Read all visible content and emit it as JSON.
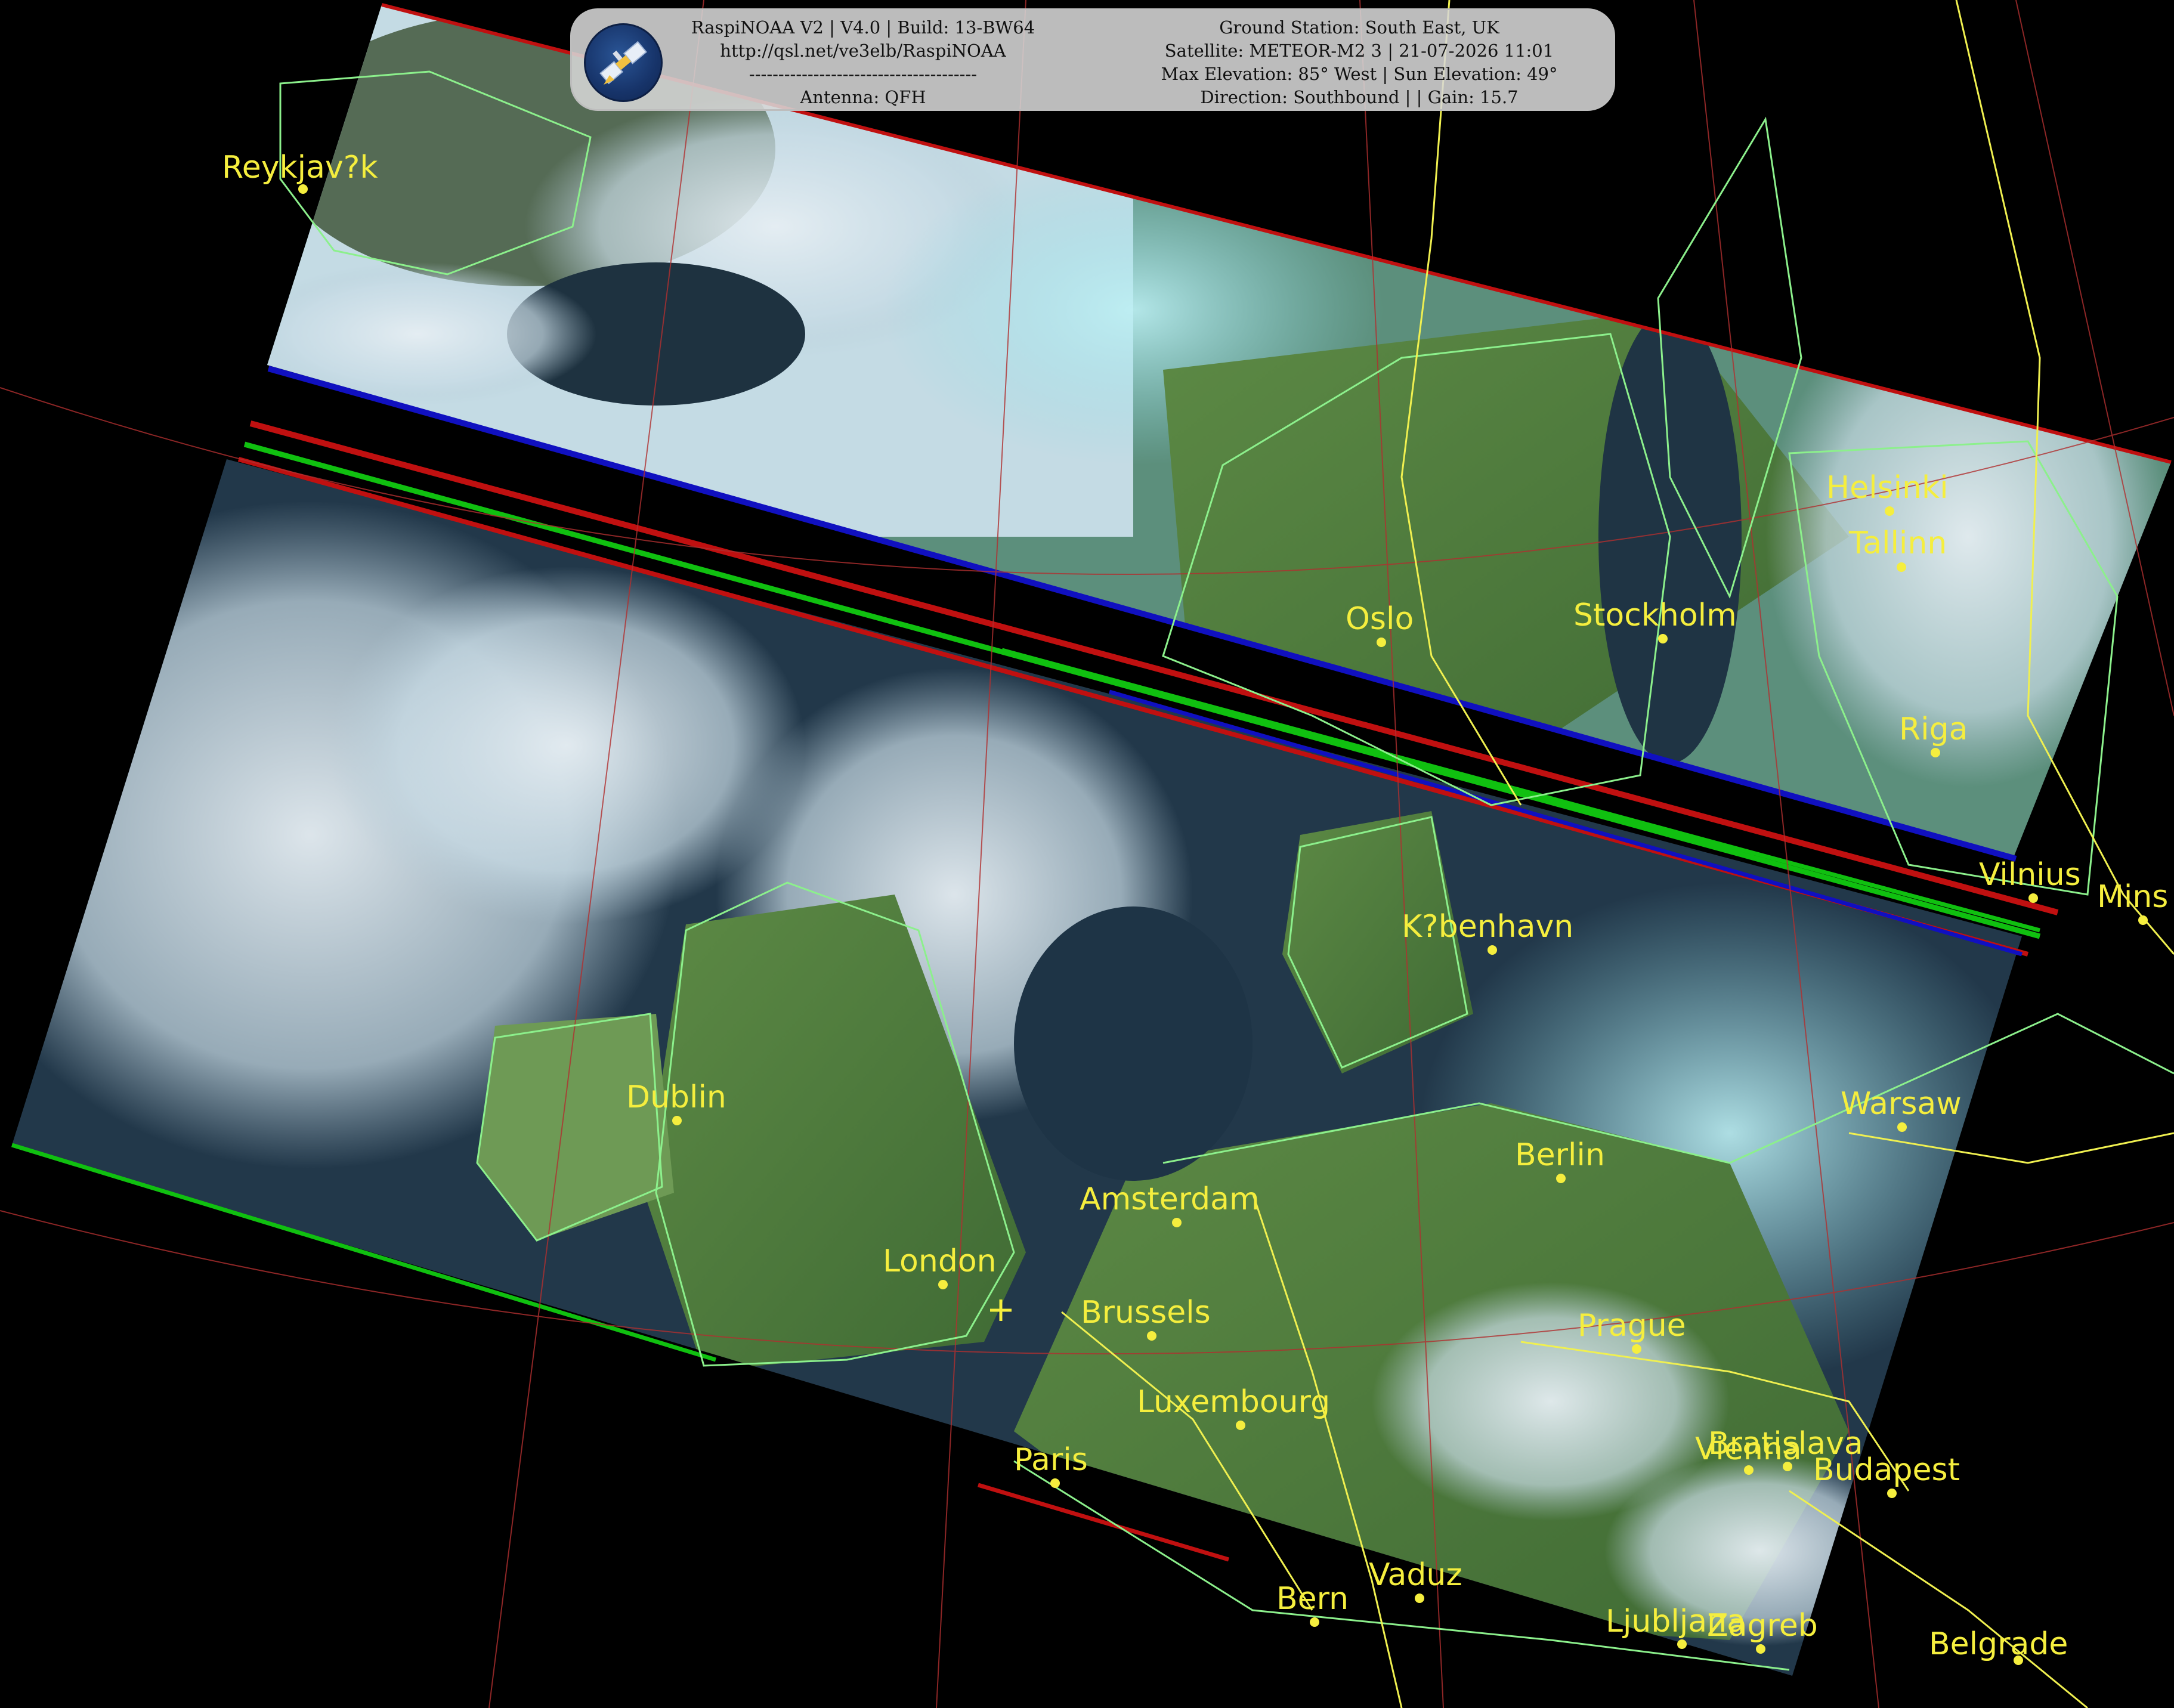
{
  "header": {
    "software_line": "RaspiNOAA V2 | V4.0 | Build: 13-BW64",
    "url_line": "http://qsl.net/ve3elb/RaspiNOAA",
    "divider_line": "---------------------------------------",
    "antenna_line": "Antenna: QFH",
    "station_line": "Ground Station: South East, UK",
    "satellite_line": "Satellite: METEOR-M2 3 | 21-07-2026 11:01",
    "elevation_line": "Max Elevation: 85° West | Sun Elevation: 49°",
    "direction_line": "Direction: Southbound | | Gain: 15.7"
  },
  "icons": {
    "logo": "satellite-logo-icon",
    "ground_station": "ground-station-crosshair-icon"
  },
  "colors": {
    "city": "#f5ee3e",
    "coastline": "#8cf08c",
    "border": "#f0f050",
    "graticule": "#b03030",
    "cloud": "#d6e6ef",
    "land": "#4a7a3c",
    "sea": "#1a2e3c"
  },
  "cities": [
    {
      "name": "Reykjav?k"
    },
    {
      "name": "Helsinki"
    },
    {
      "name": "Tallinn"
    },
    {
      "name": "Oslo"
    },
    {
      "name": "Stockholm"
    },
    {
      "name": "Riga"
    },
    {
      "name": "Vilnius"
    },
    {
      "name": "Mins"
    },
    {
      "name": "K?benhavn"
    },
    {
      "name": "Dublin"
    },
    {
      "name": "Warsaw"
    },
    {
      "name": "Berlin"
    },
    {
      "name": "Amsterdam"
    },
    {
      "name": "London"
    },
    {
      "name": "Brussels"
    },
    {
      "name": "Prague"
    },
    {
      "name": "Luxembourg"
    },
    {
      "name": "Bratislava"
    },
    {
      "name": "Vienna"
    },
    {
      "name": "Budapest"
    },
    {
      "name": "Paris"
    },
    {
      "name": "Vaduz"
    },
    {
      "name": "Bern"
    },
    {
      "name": "Ljubljana"
    },
    {
      "name": "Zagreb"
    },
    {
      "name": "Belgrade"
    }
  ]
}
